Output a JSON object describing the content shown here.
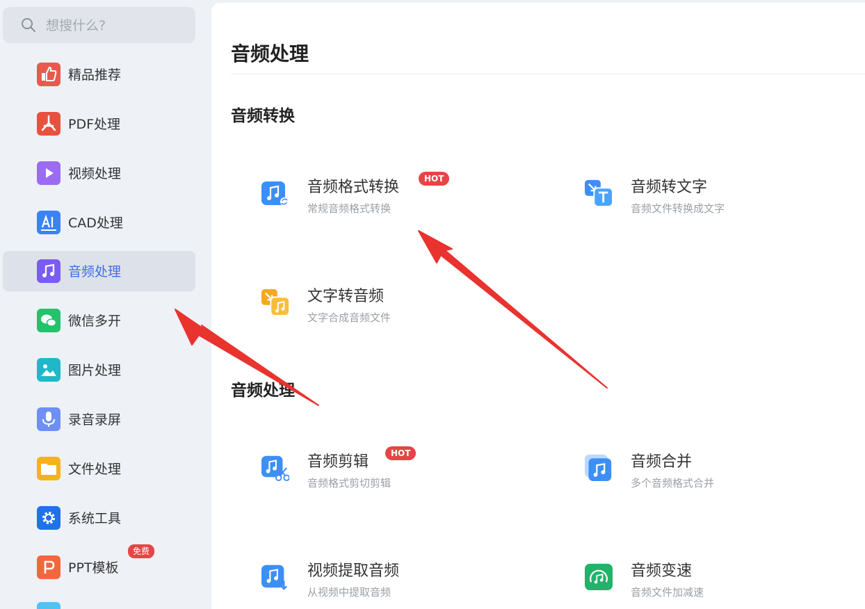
{
  "search": {
    "placeholder": "想搜什么?"
  },
  "sidebar": {
    "items": [
      {
        "label": "精品推荐",
        "icon": "thumbs-up-icon",
        "color": "#e85a4f"
      },
      {
        "label": "PDF处理",
        "icon": "pdf-icon",
        "color": "#e8513f"
      },
      {
        "label": "视频处理",
        "icon": "play-icon",
        "color": "#9b6cf2"
      },
      {
        "label": "CAD处理",
        "icon": "cad-icon",
        "color": "#3b82f6"
      },
      {
        "label": "音频处理",
        "icon": "music-note-icon",
        "color": "#7b5cf0"
      },
      {
        "label": "微信多开",
        "icon": "wechat-icon",
        "color": "#22c36b"
      },
      {
        "label": "图片处理",
        "icon": "image-icon",
        "color": "#1fb8c9"
      },
      {
        "label": "录音录屏",
        "icon": "microphone-icon",
        "color": "#6e8ff5"
      },
      {
        "label": "文件处理",
        "icon": "folder-icon",
        "color": "#f6b21c"
      },
      {
        "label": "系统工具",
        "icon": "gear-icon",
        "color": "#1f72e8"
      },
      {
        "label": "PPT模板",
        "icon": "ppt-icon",
        "color": "#f2683d",
        "badge": "免费"
      }
    ]
  },
  "main": {
    "title": "音频处理",
    "sections": [
      {
        "title": "音频转换",
        "tools": [
          {
            "name": "音频格式转换",
            "desc": "常规音频格式转换",
            "badge": "HOT",
            "icon": "audio-convert-icon"
          },
          {
            "name": "音频转文字",
            "desc": "音频文件转换成文字",
            "icon": "audio-to-text-icon"
          },
          {
            "name": "文字转音频",
            "desc": "文字合成音频文件",
            "icon": "text-to-audio-icon"
          }
        ]
      },
      {
        "title": "音频处理",
        "tools": [
          {
            "name": "音频剪辑",
            "desc": "音频格式剪切剪辑",
            "badge": "HOT",
            "icon": "audio-cut-icon"
          },
          {
            "name": "音频合并",
            "desc": "多个音频格式合并",
            "icon": "audio-merge-icon"
          },
          {
            "name": "视频提取音频",
            "desc": "从视频中提取音频",
            "icon": "video-extract-audio-icon"
          },
          {
            "name": "音频变速",
            "desc": "音频文件加减速",
            "icon": "audio-speed-icon"
          }
        ]
      }
    ]
  },
  "colors": {
    "accent": "#3d6ee8",
    "hot": "#e64545",
    "arrow": "#e8332f"
  }
}
